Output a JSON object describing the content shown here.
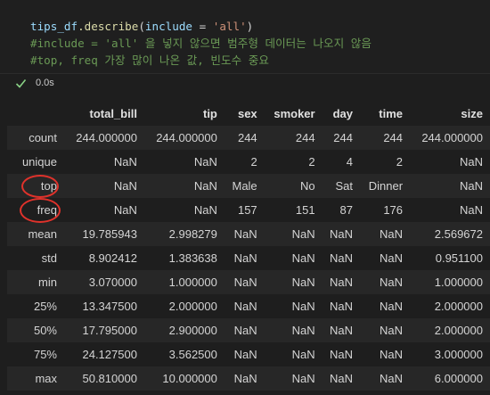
{
  "code": {
    "line1_call_obj": "tips_df",
    "line1_call_fn": ".describe",
    "line1_open": "(",
    "line1_kw": "include",
    "line1_eq": " = ",
    "line1_str": "'all'",
    "line1_close": ")",
    "line2": "#include = 'all' 을 넣지 않으면 범주형 데이터는 나오지 않음",
    "line3": "#top, freq 가장 많이 나온 값, 빈도수 중요"
  },
  "status": {
    "icon": "check-icon",
    "duration": "0.0s",
    "color": "#89d185"
  },
  "table": {
    "columns": [
      "",
      "total_bill",
      "tip",
      "sex",
      "smoker",
      "day",
      "time",
      "size"
    ],
    "rows": [
      [
        "count",
        "244.000000",
        "244.000000",
        "244",
        "244",
        "244",
        "244",
        "244.000000"
      ],
      [
        "unique",
        "NaN",
        "NaN",
        "2",
        "2",
        "4",
        "2",
        "NaN"
      ],
      [
        "top",
        "NaN",
        "NaN",
        "Male",
        "No",
        "Sat",
        "Dinner",
        "NaN"
      ],
      [
        "freq",
        "NaN",
        "NaN",
        "157",
        "151",
        "87",
        "176",
        "NaN"
      ],
      [
        "mean",
        "19.785943",
        "2.998279",
        "NaN",
        "NaN",
        "NaN",
        "NaN",
        "2.569672"
      ],
      [
        "std",
        "8.902412",
        "1.383638",
        "NaN",
        "NaN",
        "NaN",
        "NaN",
        "0.951100"
      ],
      [
        "min",
        "3.070000",
        "1.000000",
        "NaN",
        "NaN",
        "NaN",
        "NaN",
        "1.000000"
      ],
      [
        "25%",
        "13.347500",
        "2.000000",
        "NaN",
        "NaN",
        "NaN",
        "NaN",
        "2.000000"
      ],
      [
        "50%",
        "17.795000",
        "2.900000",
        "NaN",
        "NaN",
        "NaN",
        "NaN",
        "2.000000"
      ],
      [
        "75%",
        "24.127500",
        "3.562500",
        "NaN",
        "NaN",
        "NaN",
        "NaN",
        "3.000000"
      ],
      [
        "max",
        "50.810000",
        "10.000000",
        "NaN",
        "NaN",
        "NaN",
        "NaN",
        "6.000000"
      ]
    ]
  },
  "annotation_color": "#e0322b"
}
